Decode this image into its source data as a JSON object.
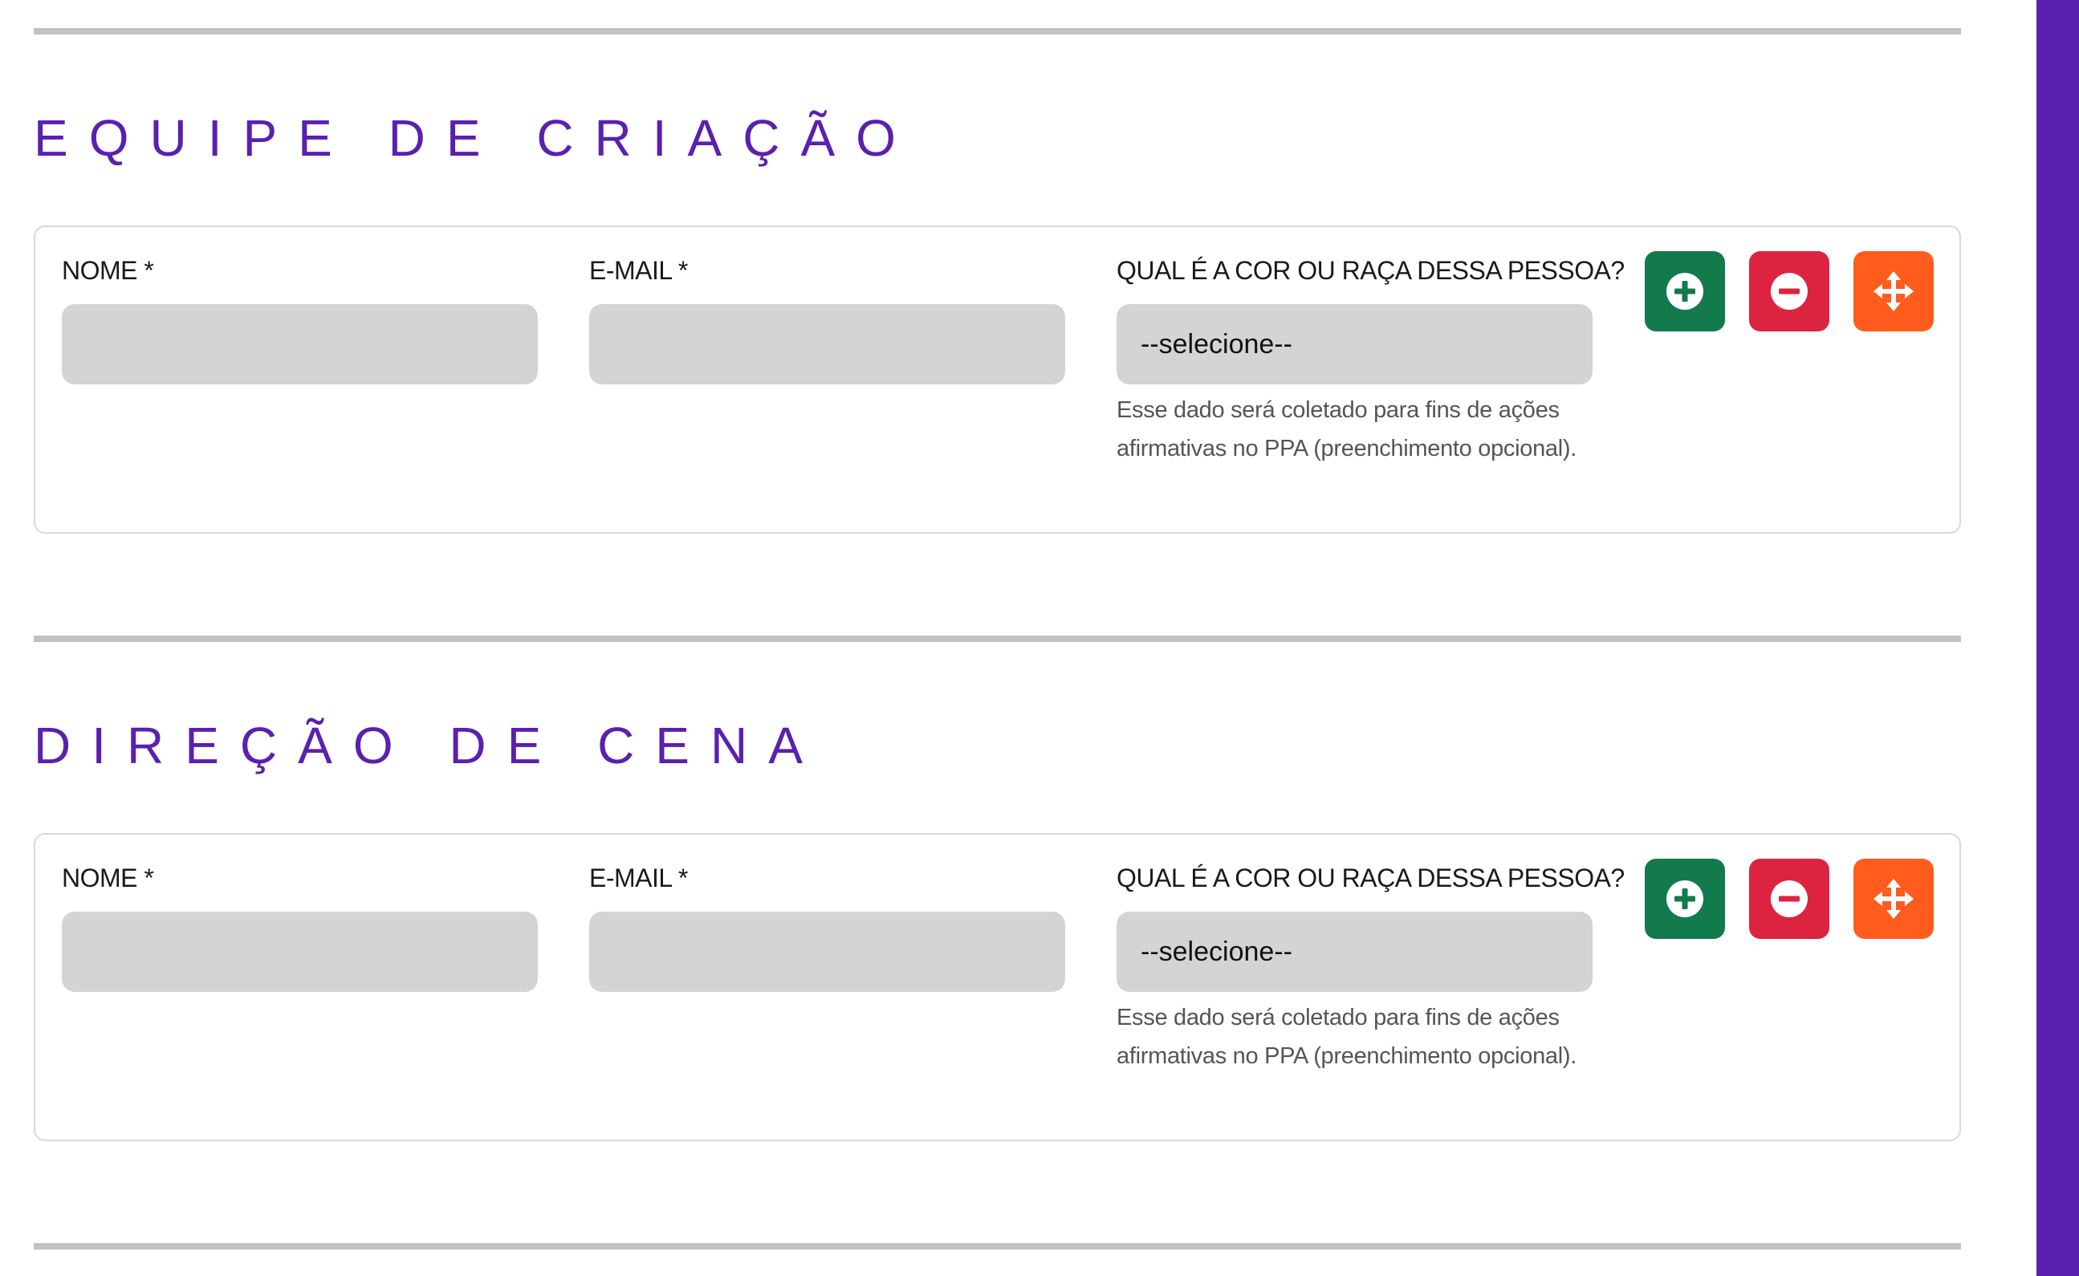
{
  "colors": {
    "accent": "#5a20b0",
    "add_button": "#137a4e",
    "remove_button": "#dc2440",
    "move_button": "#ff5c1e",
    "divider": "#c2c2c2",
    "input_background": "#d4d4d4"
  },
  "sections": [
    {
      "title": "EQUIPE DE CRIAÇÃO",
      "fields": {
        "name_label": "NOME *",
        "email_label": "E-MAIL *",
        "race_label": "QUAL É A COR OU RAÇA DESSA PESSOA?",
        "race_value": "--selecione--",
        "race_help_line1": "Esse dado será coletado para fins de ações",
        "race_help_line2": "afirmativas no PPA (preenchimento opcional)."
      },
      "actions": {
        "add_icon": "plus-circle-icon",
        "remove_icon": "minus-circle-icon",
        "move_icon": "arrows-move-icon"
      }
    },
    {
      "title": "DIREÇÃO DE CENA",
      "fields": {
        "name_label": "NOME *",
        "email_label": "E-MAIL *",
        "race_label": "QUAL É A COR OU RAÇA DESSA PESSOA?",
        "race_value": "--selecione--",
        "race_help_line1": "Esse dado será coletado para fins de ações",
        "race_help_line2": "afirmativas no PPA (preenchimento opcional)."
      },
      "actions": {
        "add_icon": "plus-circle-icon",
        "remove_icon": "minus-circle-icon",
        "move_icon": "arrows-move-icon"
      }
    }
  ]
}
